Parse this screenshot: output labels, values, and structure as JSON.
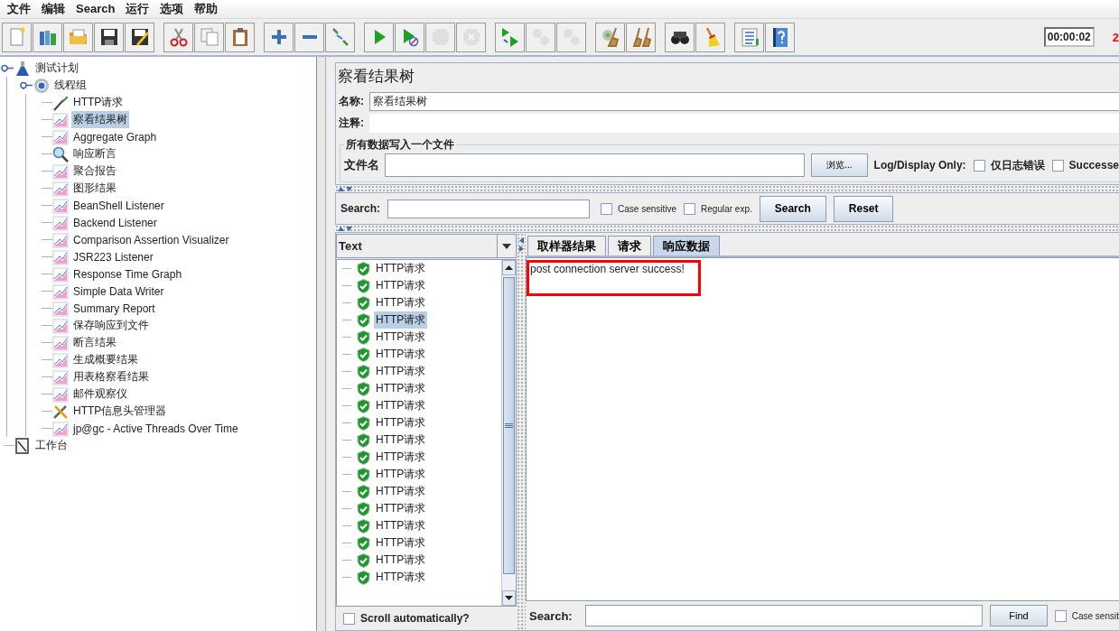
{
  "menu": [
    "文件",
    "编辑",
    "Search",
    "运行",
    "选项",
    "帮助"
  ],
  "toolbar": [
    [
      {
        "kind": "new",
        "disabled": false
      },
      {
        "kind": "templates",
        "disabled": false
      },
      {
        "kind": "open",
        "disabled": false
      },
      {
        "kind": "save",
        "disabled": false
      },
      {
        "kind": "save_as",
        "disabled": false
      }
    ],
    [
      {
        "kind": "cut",
        "disabled": false
      },
      {
        "kind": "copy",
        "disabled": false
      },
      {
        "kind": "paste",
        "disabled": false
      }
    ],
    [
      {
        "kind": "add",
        "disabled": false
      },
      {
        "kind": "remove",
        "disabled": false
      },
      {
        "kind": "toggle",
        "disabled": false
      }
    ],
    [
      {
        "kind": "start",
        "disabled": false
      },
      {
        "kind": "start_no_timers",
        "disabled": false
      },
      {
        "kind": "stop",
        "disabled": true
      },
      {
        "kind": "shutdown",
        "disabled": true
      }
    ],
    [
      {
        "kind": "remote_start",
        "disabled": false
      },
      {
        "kind": "remote_stop",
        "disabled": true
      },
      {
        "kind": "remote_exit",
        "disabled": true
      }
    ],
    [
      {
        "kind": "clear",
        "disabled": false
      },
      {
        "kind": "clear_all",
        "disabled": false
      }
    ],
    [
      {
        "kind": "search",
        "disabled": false
      },
      {
        "kind": "reset_search",
        "disabled": false
      }
    ],
    [
      {
        "kind": "function_helper",
        "disabled": false
      },
      {
        "kind": "help",
        "disabled": false
      }
    ]
  ],
  "timer": "00:00:02",
  "error_count": "2",
  "tree": [
    {
      "label": "测试计划",
      "kind": "flask",
      "selected": false,
      "expanded": true,
      "children": [
        {
          "label": "线程组",
          "kind": "gear",
          "selected": false,
          "expanded": true,
          "children": [
            {
              "label": "HTTP请求",
              "kind": "pipette",
              "selected": false
            },
            {
              "label": "察看结果树",
              "kind": "graph",
              "selected": true
            },
            {
              "label": "Aggregate Graph",
              "kind": "graph",
              "selected": false
            },
            {
              "label": "响应断言",
              "kind": "magnifier",
              "selected": false
            },
            {
              "label": "聚合报告",
              "kind": "graph",
              "selected": false
            },
            {
              "label": "图形结果",
              "kind": "graph",
              "selected": false
            },
            {
              "label": "BeanShell Listener",
              "kind": "graph",
              "selected": false
            },
            {
              "label": "Backend Listener",
              "kind": "graph",
              "selected": false
            },
            {
              "label": "Comparison Assertion Visualizer",
              "kind": "graph",
              "selected": false
            },
            {
              "label": "JSR223 Listener",
              "kind": "graph",
              "selected": false
            },
            {
              "label": "Response Time Graph",
              "kind": "graph",
              "selected": false
            },
            {
              "label": "Simple Data Writer",
              "kind": "graph",
              "selected": false
            },
            {
              "label": "Summary Report",
              "kind": "graph",
              "selected": false
            },
            {
              "label": "保存响应到文件",
              "kind": "graph",
              "selected": false
            },
            {
              "label": "断言结果",
              "kind": "graph",
              "selected": false
            },
            {
              "label": "生成概要结果",
              "kind": "graph",
              "selected": false
            },
            {
              "label": "用表格察看结果",
              "kind": "graph",
              "selected": false
            },
            {
              "label": "邮件观察仪",
              "kind": "graph",
              "selected": false
            },
            {
              "label": "HTTP信息头管理器",
              "kind": "tools",
              "selected": false
            },
            {
              "label": "jp@gc - Active Threads Over Time",
              "kind": "graph",
              "selected": false
            }
          ]
        }
      ]
    },
    {
      "label": "工作台",
      "kind": "notepad",
      "selected": false
    }
  ],
  "editor": {
    "title": "察看结果树",
    "name_label": "名称:",
    "name_value": "察看结果树",
    "comment_label": "注释:"
  },
  "file_group": {
    "legend": "所有数据写入一个文件",
    "filename_label": "文件名",
    "browse_button": "浏览...",
    "log_label": "Log/Display Only:",
    "checkboxes": [
      {
        "label": "仅日志错误",
        "checked": false
      },
      {
        "label": "Successe",
        "checked": false
      }
    ]
  },
  "search": {
    "label": "Search:",
    "options": [
      {
        "label": "Case sensitive",
        "checked": false
      },
      {
        "label": "Regular exp.",
        "checked": false
      }
    ],
    "buttons": [
      "Search",
      "Reset"
    ]
  },
  "results": {
    "renderer": "Text",
    "items": [
      {
        "label": "HTTP请求",
        "selected": false
      },
      {
        "label": "HTTP请求",
        "selected": false
      },
      {
        "label": "HTTP请求",
        "selected": false
      },
      {
        "label": "HTTP请求",
        "selected": true
      },
      {
        "label": "HTTP请求",
        "selected": false
      },
      {
        "label": "HTTP请求",
        "selected": false
      },
      {
        "label": "HTTP请求",
        "selected": false
      },
      {
        "label": "HTTP请求",
        "selected": false
      },
      {
        "label": "HTTP请求",
        "selected": false
      },
      {
        "label": "HTTP请求",
        "selected": false
      },
      {
        "label": "HTTP请求",
        "selected": false
      },
      {
        "label": "HTTP请求",
        "selected": false
      },
      {
        "label": "HTTP请求",
        "selected": false
      },
      {
        "label": "HTTP请求",
        "selected": false
      },
      {
        "label": "HTTP请求",
        "selected": false
      },
      {
        "label": "HTTP请求",
        "selected": false
      },
      {
        "label": "HTTP请求",
        "selected": false
      },
      {
        "label": "HTTP请求",
        "selected": false
      },
      {
        "label": "HTTP请求",
        "selected": false
      }
    ],
    "scroll_auto": {
      "label": "Scroll automatically?",
      "checked": false
    }
  },
  "tabs": [
    {
      "label": "取样器结果",
      "selected": false
    },
    {
      "label": "请求",
      "selected": false
    },
    {
      "label": "响应数据",
      "selected": true
    }
  ],
  "response": {
    "text": "post connection server success!",
    "highlighted": true
  },
  "find": {
    "label": "Search:",
    "button": "Find",
    "option": {
      "label": "Case sensit",
      "checked": false
    }
  }
}
